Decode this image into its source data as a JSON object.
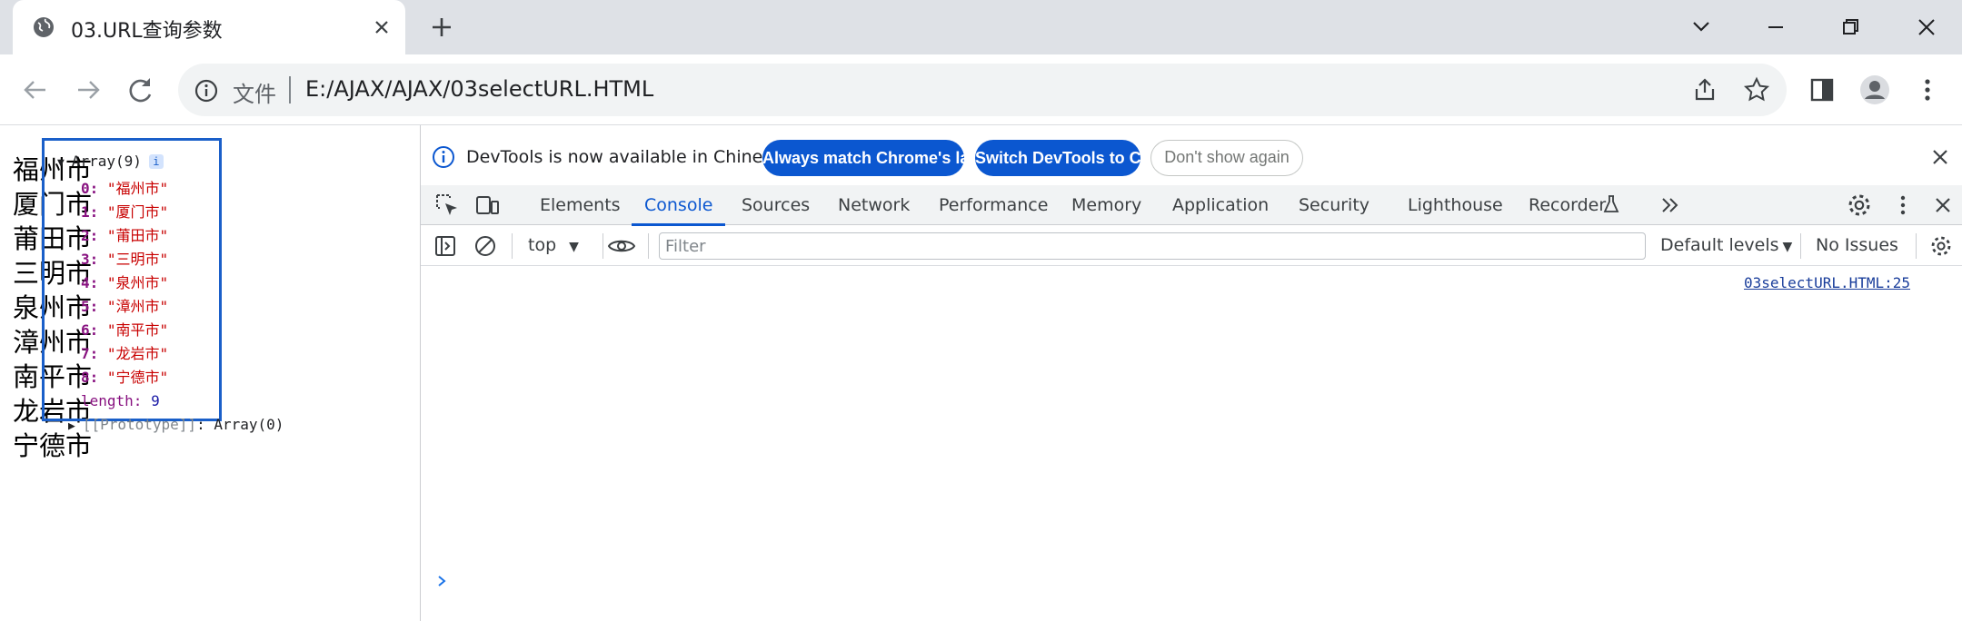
{
  "browser": {
    "tab": {
      "title": "03.URL查询参数",
      "favicon": "globe-icon"
    },
    "toolbar": {
      "omnibox_prefix": "文件",
      "url": "E:/AJAX/AJAX/03selectURL.HTML"
    }
  },
  "page": {
    "cities": [
      "福州市",
      "厦门市",
      "莆田市",
      "三明市",
      "泉州市",
      "漳州市",
      "南平市",
      "龙岩市",
      "宁德市"
    ]
  },
  "devtools": {
    "infobar": {
      "text": "DevTools is now available in Chinese!",
      "btn_match": "Always match Chrome's language",
      "btn_switch": "Switch DevTools to Chinese",
      "btn_dismiss": "Don't show again"
    },
    "tabs": [
      "Elements",
      "Console",
      "Sources",
      "Network",
      "Performance",
      "Memory",
      "Application",
      "Security",
      "Lighthouse",
      "Recorder"
    ],
    "active_tab": "Console",
    "console_bar": {
      "context": "top",
      "filter_placeholder": "Filter",
      "levels": "Default levels",
      "issues": "No Issues"
    },
    "log": {
      "source": "03selectURL.HTML:25",
      "header": "Array(9)",
      "badge": "i",
      "items": [
        {
          "key": "0",
          "value": "\"福州市\""
        },
        {
          "key": "1",
          "value": "\"厦门市\""
        },
        {
          "key": "2",
          "value": "\"莆田市\""
        },
        {
          "key": "3",
          "value": "\"三明市\""
        },
        {
          "key": "4",
          "value": "\"泉州市\""
        },
        {
          "key": "5",
          "value": "\"漳州市\""
        },
        {
          "key": "6",
          "value": "\"南平市\""
        },
        {
          "key": "7",
          "value": "\"龙岩市\""
        },
        {
          "key": "8",
          "value": "\"宁德市\""
        }
      ],
      "length_key": "length",
      "length_value": "9",
      "proto_key": "[[Prototype]]",
      "proto_value": "Array(0)"
    }
  },
  "colors": {
    "accent": "#0b57d0",
    "highlight_border": "#1a5fc9",
    "string_value": "#c80000",
    "property_key": "#881280"
  }
}
